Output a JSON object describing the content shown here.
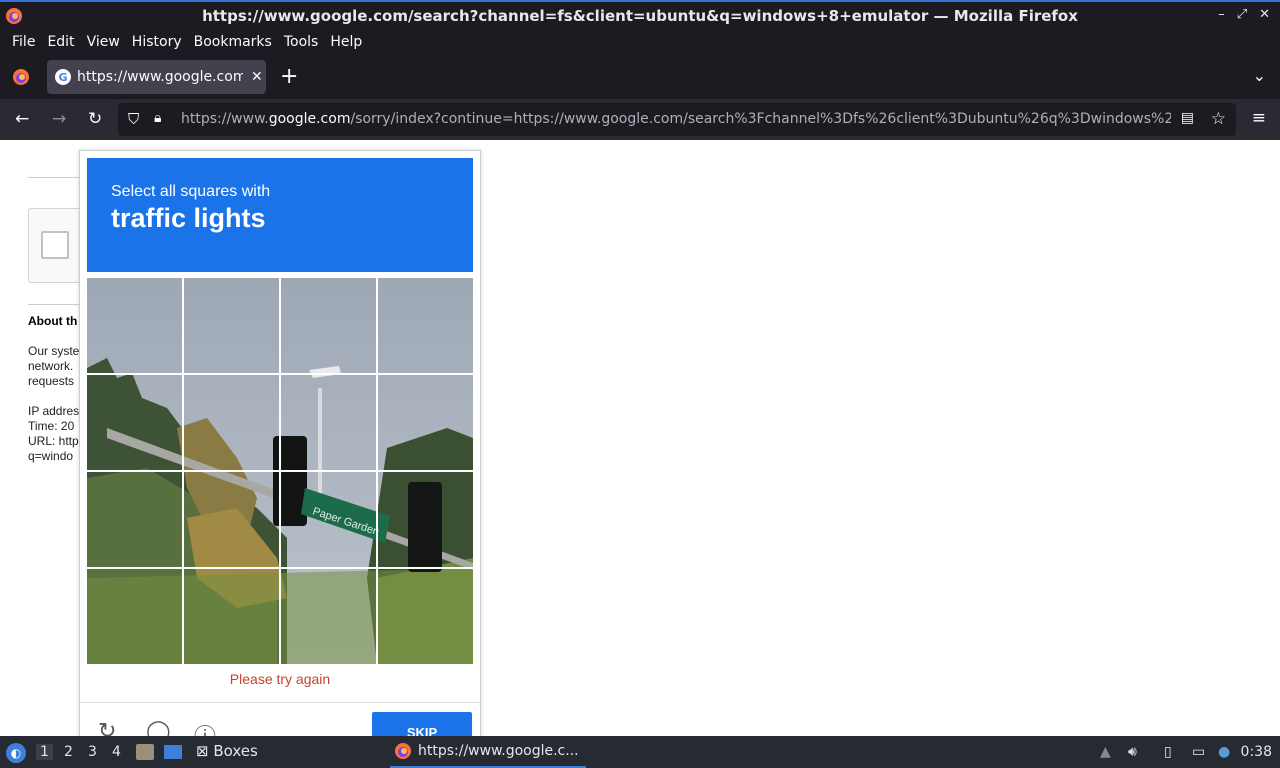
{
  "window": {
    "title": "https://www.google.com/search?channel=fs&client=ubuntu&q=windows+8+emulator — Mozilla Firefox",
    "controls": [
      "–",
      "⤢",
      "✕"
    ]
  },
  "menubar": {
    "items": [
      "File",
      "Edit",
      "View",
      "History",
      "Bookmarks",
      "Tools",
      "Help"
    ]
  },
  "tabs": {
    "active_tab_title": "https://www.google.com/sorry/index?continue=",
    "close_glyph": "✕",
    "new_tab_glyph": "+",
    "list_glyph": "⌄"
  },
  "navbar": {
    "back": "←",
    "forward": "→",
    "reload": "↻",
    "url_prefix": "https://www.",
    "url_domain": "google.com",
    "url_rest": "/sorry/index?continue=https://www.google.com/search%3Fchannel%3Dfs%26client%3Dubuntu%26q%3Dwindows%2",
    "menu": "≡"
  },
  "page": {
    "about_heading": "About th",
    "bg_lines": [
      "Our syste",
      "network.",
      "requests",
      "",
      "IP addres",
      "Time: 20",
      "URL: http",
      "q=windo"
    ]
  },
  "captcha": {
    "instruction": "Select all squares with",
    "target": "traffic lights",
    "error": "Please try again",
    "skip_label": "SKIP",
    "grid_rows": 4,
    "grid_cols": 4
  },
  "taskbar": {
    "workspaces": [
      "1",
      "2",
      "3",
      "4"
    ],
    "boxes_label": "Boxes",
    "task_title": "https://www.google.c...",
    "clock": "0:38"
  },
  "colors": {
    "captcha_blue": "#1a73e8",
    "error_red": "#c5442b",
    "firefox_dark": "#1c1b22",
    "navbar": "#2b2a33"
  }
}
